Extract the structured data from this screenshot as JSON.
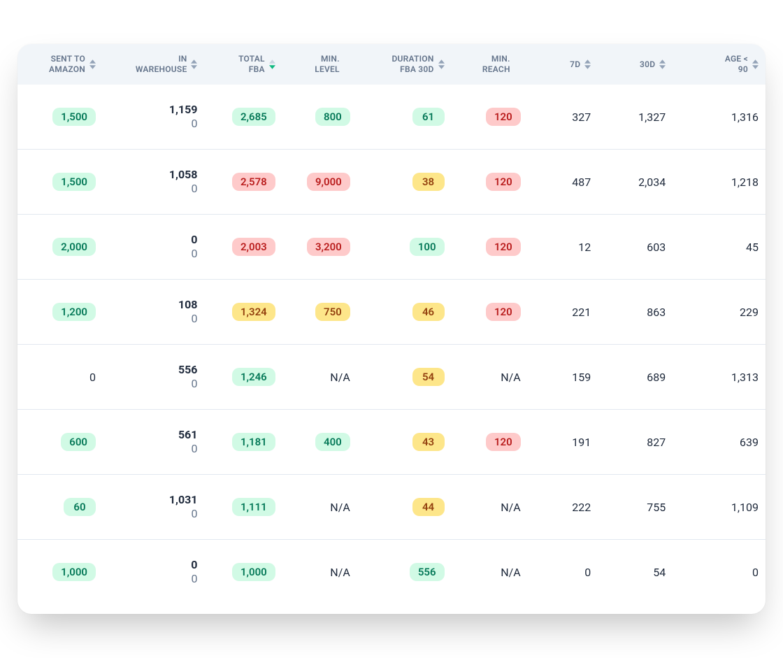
{
  "colors": {
    "green_bg": "#d1fae5",
    "green_text": "#047857",
    "red_bg": "#fecaca",
    "red_text": "#b91c1c",
    "amber_bg": "#fde68a",
    "amber_text": "#92400e"
  },
  "columns": [
    {
      "key": "sent_to_amazon",
      "label": "SENT TO\nAMAZON",
      "sort": "both"
    },
    {
      "key": "in_warehouse",
      "label": "IN\nWAREHOUSE",
      "sort": "both"
    },
    {
      "key": "total_fba",
      "label": "TOTAL\nFBA",
      "sort": "desc"
    },
    {
      "key": "min_level",
      "label": "MIN.\nLEVEL",
      "sort": "none"
    },
    {
      "key": "duration_fba30",
      "label": "DURATION\nFBA 30D",
      "sort": "both"
    },
    {
      "key": "min_reach",
      "label": "MIN.\nREACH",
      "sort": "none"
    },
    {
      "key": "d7",
      "label": "7D",
      "sort": "both"
    },
    {
      "key": "d30",
      "label": "30D",
      "sort": "both"
    },
    {
      "key": "age90",
      "label": "AGE <\n90",
      "sort": "both"
    }
  ],
  "rows": [
    {
      "sent_to_amazon": {
        "text": "1,500",
        "pill": "green"
      },
      "in_warehouse": {
        "top": "1,159",
        "bottom": "0"
      },
      "total_fba": {
        "text": "2,685",
        "pill": "green"
      },
      "min_level": {
        "text": "800",
        "pill": "green"
      },
      "duration_fba30": {
        "text": "61",
        "pill": "green"
      },
      "min_reach": {
        "text": "120",
        "pill": "red"
      },
      "d7": {
        "text": "327"
      },
      "d30": {
        "text": "1,327"
      },
      "age90": {
        "text": "1,316"
      }
    },
    {
      "sent_to_amazon": {
        "text": "1,500",
        "pill": "green"
      },
      "in_warehouse": {
        "top": "1,058",
        "bottom": "0"
      },
      "total_fba": {
        "text": "2,578",
        "pill": "red"
      },
      "min_level": {
        "text": "9,000",
        "pill": "red"
      },
      "duration_fba30": {
        "text": "38",
        "pill": "amber"
      },
      "min_reach": {
        "text": "120",
        "pill": "red"
      },
      "d7": {
        "text": "487"
      },
      "d30": {
        "text": "2,034"
      },
      "age90": {
        "text": "1,218"
      }
    },
    {
      "sent_to_amazon": {
        "text": "2,000",
        "pill": "green"
      },
      "in_warehouse": {
        "top": "0",
        "bottom": "0"
      },
      "total_fba": {
        "text": "2,003",
        "pill": "red"
      },
      "min_level": {
        "text": "3,200",
        "pill": "red"
      },
      "duration_fba30": {
        "text": "100",
        "pill": "green"
      },
      "min_reach": {
        "text": "120",
        "pill": "red"
      },
      "d7": {
        "text": "12"
      },
      "d30": {
        "text": "603"
      },
      "age90": {
        "text": "45"
      }
    },
    {
      "sent_to_amazon": {
        "text": "1,200",
        "pill": "green"
      },
      "in_warehouse": {
        "top": "108",
        "bottom": "0"
      },
      "total_fba": {
        "text": "1,324",
        "pill": "amber"
      },
      "min_level": {
        "text": "750",
        "pill": "amber"
      },
      "duration_fba30": {
        "text": "46",
        "pill": "amber"
      },
      "min_reach": {
        "text": "120",
        "pill": "red"
      },
      "d7": {
        "text": "221"
      },
      "d30": {
        "text": "863"
      },
      "age90": {
        "text": "229"
      }
    },
    {
      "sent_to_amazon": {
        "text": "0"
      },
      "in_warehouse": {
        "top": "556",
        "bottom": "0"
      },
      "total_fba": {
        "text": "1,246",
        "pill": "green"
      },
      "min_level": {
        "text": "N/A"
      },
      "duration_fba30": {
        "text": "54",
        "pill": "amber"
      },
      "min_reach": {
        "text": "N/A"
      },
      "d7": {
        "text": "159"
      },
      "d30": {
        "text": "689"
      },
      "age90": {
        "text": "1,313"
      }
    },
    {
      "sent_to_amazon": {
        "text": "600",
        "pill": "green"
      },
      "in_warehouse": {
        "top": "561",
        "bottom": "0"
      },
      "total_fba": {
        "text": "1,181",
        "pill": "green"
      },
      "min_level": {
        "text": "400",
        "pill": "green"
      },
      "duration_fba30": {
        "text": "43",
        "pill": "amber"
      },
      "min_reach": {
        "text": "120",
        "pill": "red"
      },
      "d7": {
        "text": "191"
      },
      "d30": {
        "text": "827"
      },
      "age90": {
        "text": "639"
      }
    },
    {
      "sent_to_amazon": {
        "text": "60",
        "pill": "green"
      },
      "in_warehouse": {
        "top": "1,031",
        "bottom": "0"
      },
      "total_fba": {
        "text": "1,111",
        "pill": "green"
      },
      "min_level": {
        "text": "N/A"
      },
      "duration_fba30": {
        "text": "44",
        "pill": "amber"
      },
      "min_reach": {
        "text": "N/A"
      },
      "d7": {
        "text": "222"
      },
      "d30": {
        "text": "755"
      },
      "age90": {
        "text": "1,109"
      }
    },
    {
      "sent_to_amazon": {
        "text": "1,000",
        "pill": "green"
      },
      "in_warehouse": {
        "top": "0",
        "bottom": "0"
      },
      "total_fba": {
        "text": "1,000",
        "pill": "green"
      },
      "min_level": {
        "text": "N/A"
      },
      "duration_fba30": {
        "text": "556",
        "pill": "green"
      },
      "min_reach": {
        "text": "N/A"
      },
      "d7": {
        "text": "0"
      },
      "d30": {
        "text": "54"
      },
      "age90": {
        "text": "0"
      }
    }
  ]
}
